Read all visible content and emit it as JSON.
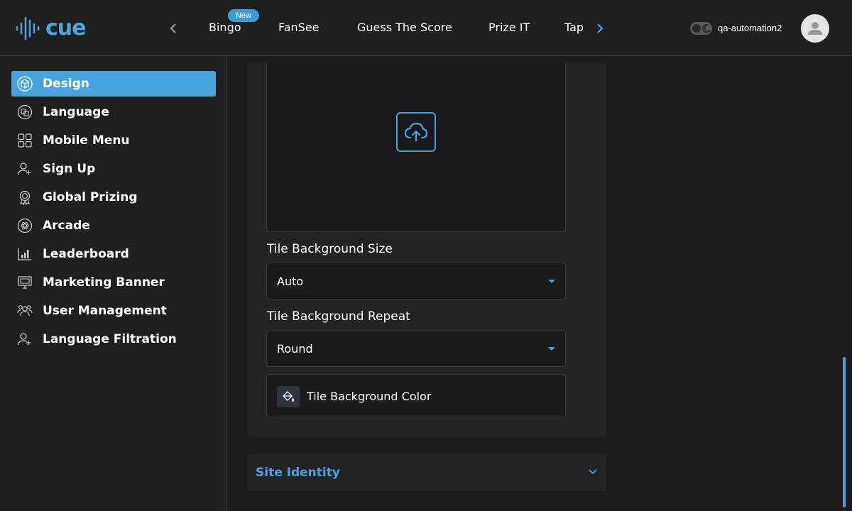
{
  "brand": {
    "logo_text": "cue",
    "accent_color": "#4aa3dc"
  },
  "header": {
    "tabs": [
      {
        "label": "Bingo"
      },
      {
        "label": "FanSee"
      },
      {
        "label": "Guess The Score"
      },
      {
        "label": "Prize IT"
      },
      {
        "label": "Tap"
      }
    ],
    "new_badge": "New",
    "user_name": "qa-automation2",
    "icons": {
      "prev": "chevron-left-icon",
      "next": "chevron-right-icon",
      "theme": "moon-icon",
      "avatar": "user-avatar-icon"
    }
  },
  "sidebar": {
    "items": [
      {
        "label": "Design",
        "icon": "cube-icon",
        "active": true
      },
      {
        "label": "Language",
        "icon": "translate-icon"
      },
      {
        "label": "Mobile Menu",
        "icon": "grid-icon"
      },
      {
        "label": "Sign Up",
        "icon": "user-plus-icon"
      },
      {
        "label": "Global Prizing",
        "icon": "award-icon"
      },
      {
        "label": "Arcade",
        "icon": "atom-icon"
      },
      {
        "label": "Leaderboard",
        "icon": "chart-icon"
      },
      {
        "label": "Marketing Banner",
        "icon": "monitor-icon"
      },
      {
        "label": "User Management",
        "icon": "users-icon"
      },
      {
        "label": "Language Filtration",
        "icon": "user-plus-icon"
      }
    ]
  },
  "main": {
    "upload_icon": "cloud-upload-icon",
    "bg_size": {
      "label": "Tile Background Size",
      "value": "Auto"
    },
    "bg_repeat": {
      "label": "Tile Background Repeat",
      "value": "Round"
    },
    "bg_color": {
      "label": "Tile Background Color",
      "icon": "paint-bucket-icon"
    },
    "site_identity": {
      "title": "Site Identity",
      "icon": "chevron-down-icon"
    }
  }
}
